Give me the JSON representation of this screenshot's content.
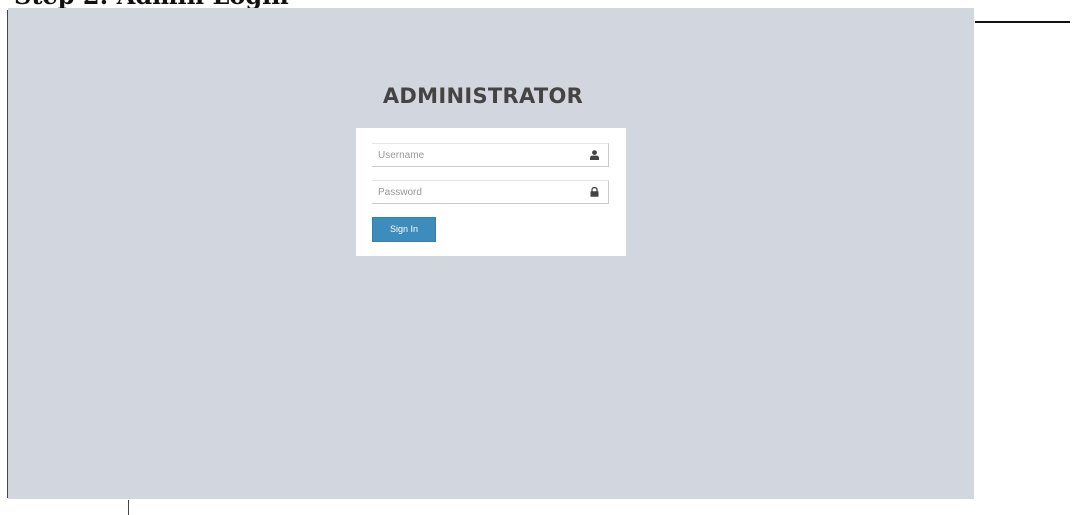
{
  "page": {
    "heading": "Step 2: Admin Login"
  },
  "login": {
    "title": "ADMINISTRATOR",
    "username_placeholder": "Username",
    "username_value": "",
    "password_placeholder": "Password",
    "password_value": "",
    "signin_label": "Sign In",
    "username_icon": "user-icon",
    "password_icon": "lock-icon"
  },
  "colors": {
    "screen_background": "#d2d6de",
    "box_background": "#ffffff",
    "button": "#3c8dbc",
    "title_text": "#444444"
  }
}
